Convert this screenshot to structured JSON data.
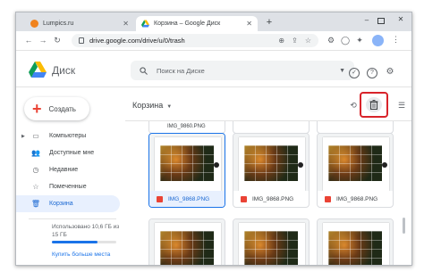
{
  "browser": {
    "tabs": [
      {
        "title": "Lumpics.ru",
        "active": false
      },
      {
        "title": "Корзина – Google Диск",
        "active": true
      }
    ],
    "new_tab": "+",
    "url": "drive.google.com/drive/u/0/trash"
  },
  "drive": {
    "brand": "Диск",
    "search_placeholder": "Поиск на Диске",
    "create_label": "Создать",
    "nav": [
      {
        "label": "Компьютеры",
        "icon": "computer-icon",
        "has_arrow": true
      },
      {
        "label": "Доступные мне",
        "icon": "shared-icon"
      },
      {
        "label": "Недавние",
        "icon": "clock-icon"
      },
      {
        "label": "Помеченные",
        "icon": "star-icon"
      },
      {
        "label": "Корзина",
        "icon": "trash-icon",
        "active": true
      }
    ],
    "storage": {
      "text": "Использовано 10,6 ГБ из 15 ГБ",
      "fraction": 0.71,
      "buy_label": "Купить больше места"
    },
    "folder_title": "Корзина",
    "files": [
      {
        "top": "IMG_9860.PNG",
        "name": "IMG_9868.PNG",
        "selected": true
      },
      {
        "name": "IMG_9868.PNG"
      },
      {
        "name": "IMG_9868.PNG"
      }
    ]
  },
  "colors": {
    "accent": "#1a73e8",
    "highlight_frame": "#d8232a",
    "selected_bg": "#e8f0fe"
  }
}
